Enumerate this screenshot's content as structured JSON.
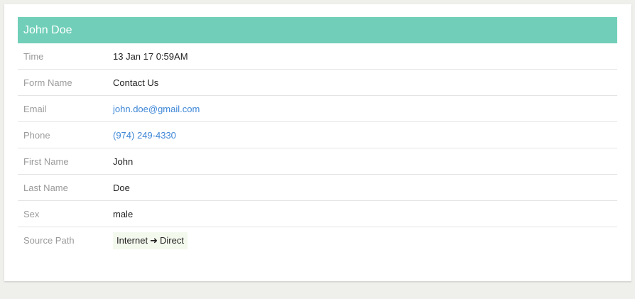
{
  "record": {
    "title": "John Doe",
    "fields": [
      {
        "label": "Time",
        "value": "13 Jan 17 0:59AM"
      },
      {
        "label": "Form Name",
        "value": "Contact Us"
      },
      {
        "label": "Email",
        "value": "john.doe@gmail.com"
      },
      {
        "label": "Phone",
        "value": "(974) 249-4330"
      },
      {
        "label": "First Name",
        "value": "John"
      },
      {
        "label": "Last Name",
        "value": "Doe"
      },
      {
        "label": "Sex",
        "value": "male"
      },
      {
        "label": "Source Path",
        "source": "Internet",
        "arrow": "➜",
        "destination": "Direct"
      }
    ]
  },
  "colors": {
    "header_bg": "#71cfb9",
    "link": "#3d86d6",
    "label": "#9a9a9a",
    "badge_bg": "#f4f9ee"
  }
}
